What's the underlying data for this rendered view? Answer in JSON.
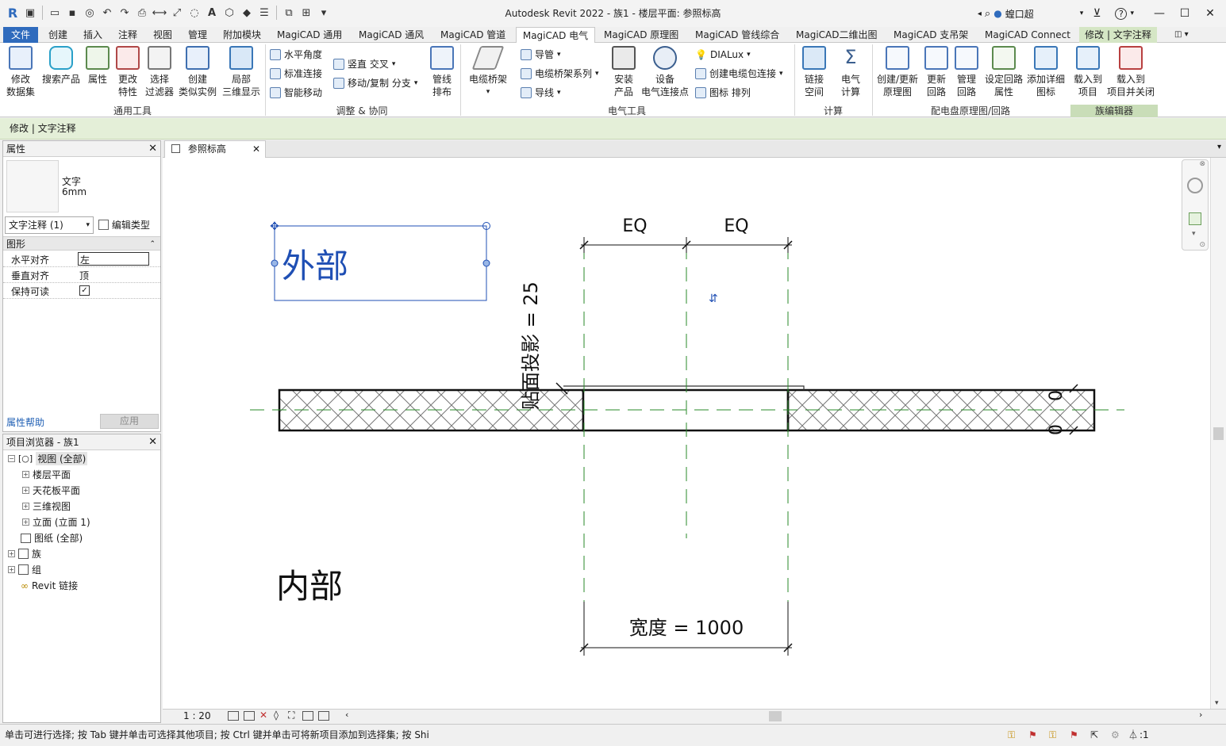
{
  "window": {
    "title": "Autodesk Revit 2022 - 族1 - 楼层平面: 参照标高",
    "user": "蝗口超"
  },
  "tabs": [
    "文件",
    "创建",
    "插入",
    "注释",
    "视图",
    "管理",
    "附加模块",
    "MagiCAD 通用",
    "MagiCAD 通风",
    "MagiCAD 管道",
    "MagiCAD 电气",
    "MagiCAD 原理图",
    "MagiCAD 管线综合",
    "MagiCAD二维出图",
    "MagiCAD 支吊架",
    "MagiCAD Connect",
    "修改 | 文字注释"
  ],
  "ribbon": {
    "g1": {
      "title": "通用工具",
      "b1a": "修改",
      "b1b": "数据集",
      "b2": "搜索产品",
      "b3": "属性",
      "b4a": "更改",
      "b4b": "特性",
      "b5a": "选择",
      "b5b": "过滤器",
      "b6a": "创建",
      "b6b": "类似实例",
      "b7a": "局部",
      "b7b": "三维显示"
    },
    "g2": {
      "title": "调整 & 协同",
      "s1": "水平角度",
      "s2": "标准连接",
      "s3": "智能移动",
      "s4": "竖直 交叉",
      "s5": "移动/复制 分支",
      "b1a": "管线",
      "b1b": "排布"
    },
    "g3": {
      "title": "电气工具",
      "b1": "电缆桥架",
      "s1": "导管",
      "s2": "电缆桥架系列",
      "s3": "导线",
      "b2a": "安装",
      "b2b": "产品",
      "b3a": "设备",
      "b3b": "电气连接点",
      "s4": "DIALux",
      "s5": "创建电缆包连接",
      "s6": "图标 排列"
    },
    "g4": {
      "title": "计算",
      "b1a": "链接",
      "b1b": "空间",
      "b2a": "电气",
      "b2b": "计算"
    },
    "g5": {
      "title": "配电盘原理图/回路",
      "b1a": "创建/更新",
      "b1b": "原理图",
      "b2a": "更新",
      "b2b": "回路",
      "b3a": "管理",
      "b3b": "回路",
      "b4a": "设定回路",
      "b4b": "属性",
      "b5a": "添加详细",
      "b5b": "图标"
    },
    "g6": {
      "title": "族编辑器",
      "b1a": "载入到",
      "b1b": "项目",
      "b2a": "载入到",
      "b2b": "项目并关闭"
    }
  },
  "context_bar": "修改 | 文字注释",
  "properties": {
    "title": "属性",
    "type_name": "文字",
    "type_sub": "6mm",
    "selector": "文字注释 (1)",
    "edit_type": "编辑类型",
    "section": "图形",
    "rows": [
      {
        "label": "水平对齐",
        "value": "左"
      },
      {
        "label": "垂直对齐",
        "value": "顶"
      },
      {
        "label": "保持可读",
        "value": "✓"
      }
    ],
    "help": "属性帮助",
    "apply": "应用"
  },
  "browser": {
    "title": "项目浏览器 - 族1",
    "items": [
      "视图 (全部)",
      "楼层平面",
      "天花板平面",
      "三维视图",
      "立面 (立面 1)",
      "图纸 (全部)",
      "族",
      "组",
      "Revit 链接"
    ]
  },
  "view_tab": "参照标高",
  "drawing": {
    "outside": "外部",
    "inside": "内部",
    "eq": "EQ",
    "offset": "贴面投影 = 25",
    "width": "宽度 = 1000",
    "zero": "0"
  },
  "scale": "1 : 20",
  "status": "单击可进行选择; 按 Tab 键并单击可选择其他项目; 按 Ctrl 键并单击可将新项目添加到选择集; 按 Shi",
  "filter_count": ":1",
  "colors": {
    "file_tab": "#2f6bbd",
    "context_bar": "#e4efd8",
    "selection": "#1f4fb4"
  }
}
